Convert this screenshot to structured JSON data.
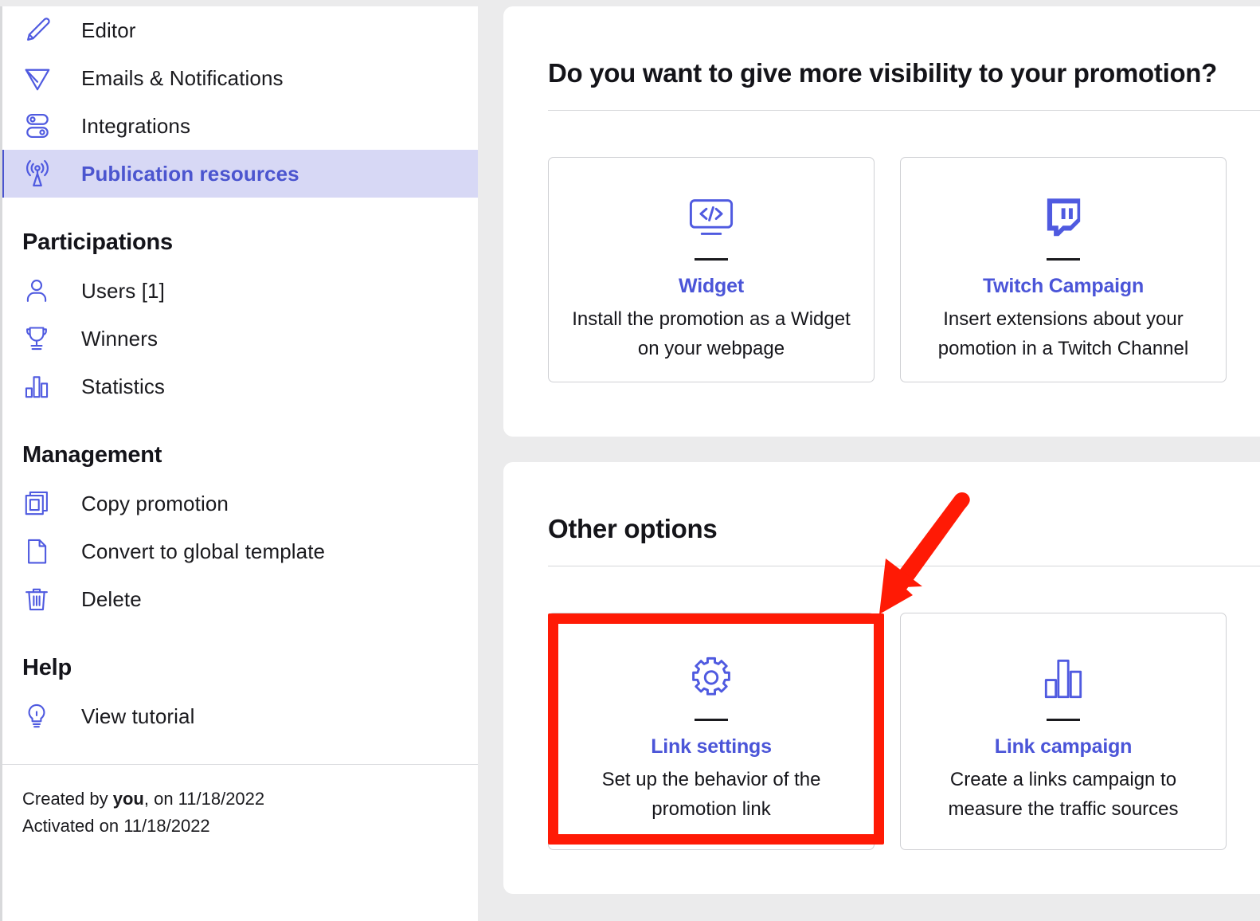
{
  "sidebar": {
    "nav_items": [
      {
        "label": "Editor",
        "icon": "pencil-icon",
        "active": false
      },
      {
        "label": "Emails & Notifications",
        "icon": "send-icon",
        "active": false
      },
      {
        "label": "Integrations",
        "icon": "toggles-icon",
        "active": false
      },
      {
        "label": "Publication resources",
        "icon": "broadcast-icon",
        "active": true
      }
    ],
    "sections": [
      {
        "title": "Participations",
        "items": [
          {
            "label": "Users [1]",
            "icon": "user-icon"
          },
          {
            "label": "Winners",
            "icon": "trophy-icon"
          },
          {
            "label": "Statistics",
            "icon": "bar-chart-icon"
          }
        ]
      },
      {
        "title": "Management",
        "items": [
          {
            "label": "Copy promotion",
            "icon": "copy-icon"
          },
          {
            "label": "Convert to global template",
            "icon": "document-icon"
          },
          {
            "label": "Delete",
            "icon": "trash-icon"
          }
        ]
      },
      {
        "title": "Help",
        "items": [
          {
            "label": "View tutorial",
            "icon": "lightbulb-icon"
          }
        ]
      }
    ],
    "footer": {
      "created_prefix": "Created by ",
      "created_author": "you",
      "created_suffix": ", on 11/18/2022",
      "activated": "Activated on 11/18/2022"
    }
  },
  "main": {
    "visibility_panel": {
      "heading": "Do you want to give more visibility to your promotion?",
      "cards": [
        {
          "icon": "code-screen-icon",
          "title": "Widget",
          "description": "Install the promotion as a Widget on your webpage"
        },
        {
          "icon": "twitch-icon",
          "title": "Twitch Campaign",
          "description": "Insert extensions about your pomotion in a Twitch Channel"
        }
      ]
    },
    "other_panel": {
      "heading": "Other options",
      "cards": [
        {
          "icon": "gear-icon",
          "title": "Link settings",
          "description": "Set up the behavior of the promotion link"
        },
        {
          "icon": "bar-chart-icon",
          "title": "Link campaign",
          "description": "Create a links campaign to measure the traffic sources"
        }
      ]
    }
  },
  "annotations": {
    "highlight_color": "#ff1a05",
    "highlight_target": "Link settings",
    "arrow_color": "#ff1a05",
    "arrow_points_to": "Link settings"
  },
  "theme": {
    "accent": "#4f5ae0",
    "accent_text": "#4b55d8",
    "active_bg": "#d7d8f5",
    "page_bg": "#ebebec",
    "panel_bg": "#ffffff",
    "border": "#cfd0d4",
    "text": "#1a1a1e"
  }
}
